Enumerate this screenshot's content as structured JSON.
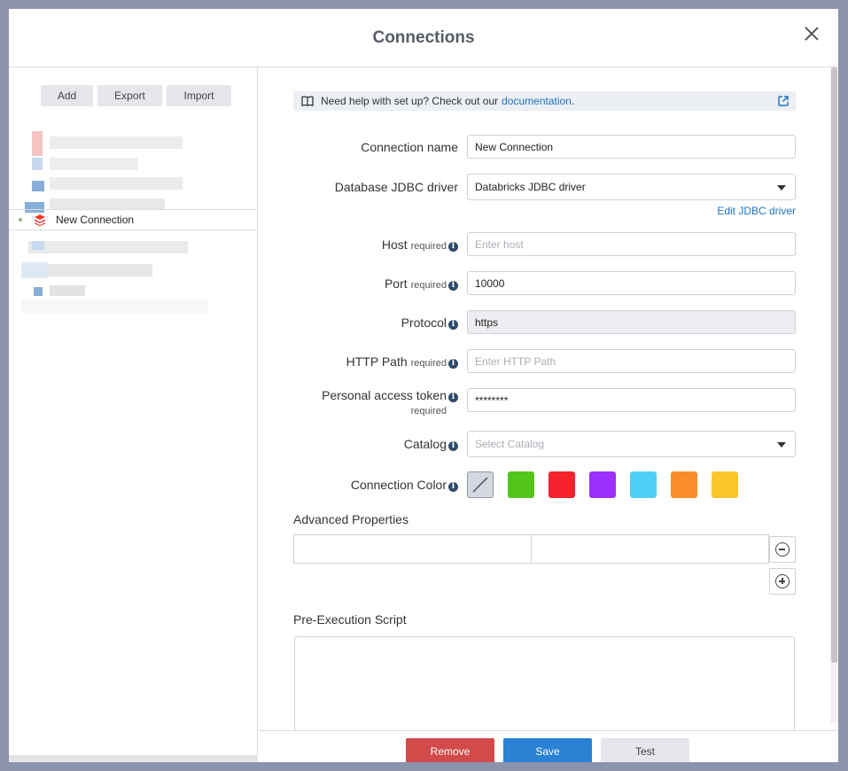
{
  "dialog": {
    "title": "Connections"
  },
  "sidebar": {
    "buttons": {
      "add": "Add",
      "export": "Export",
      "import": "Import"
    },
    "selected_connection": "New Connection"
  },
  "help": {
    "text": "Need help with set up? Check out our",
    "link": "documentation",
    "suffix": "."
  },
  "form": {
    "connection_name": {
      "label": "Connection name",
      "value": "New Connection"
    },
    "jdbc_driver": {
      "label": "Database JDBC driver",
      "value": "Databricks JDBC driver",
      "edit_link": "Edit JDBC driver"
    },
    "host": {
      "label": "Host",
      "required": "required",
      "placeholder": "Enter host"
    },
    "port": {
      "label": "Port",
      "required": "required",
      "value": "10000"
    },
    "protocol": {
      "label": "Protocol",
      "value": "https"
    },
    "http_path": {
      "label": "HTTP Path",
      "required": "required",
      "placeholder": "Enter HTTP Path"
    },
    "token": {
      "label": "Personal access token",
      "required": "required",
      "value": "********"
    },
    "catalog": {
      "label": "Catalog",
      "placeholder": "Select Catalog"
    },
    "color": {
      "label": "Connection Color",
      "swatches": [
        "none",
        "#52c41a",
        "#f5222d",
        "#9b30ff",
        "#4dd0f5",
        "#fa8c2a",
        "#fac42a"
      ]
    },
    "advanced": {
      "label": "Advanced Properties"
    },
    "pre_script": {
      "label": "Pre-Execution Script"
    }
  },
  "footer": {
    "remove": "Remove",
    "save": "Save",
    "test": "Test"
  },
  "info_glyph": "i"
}
